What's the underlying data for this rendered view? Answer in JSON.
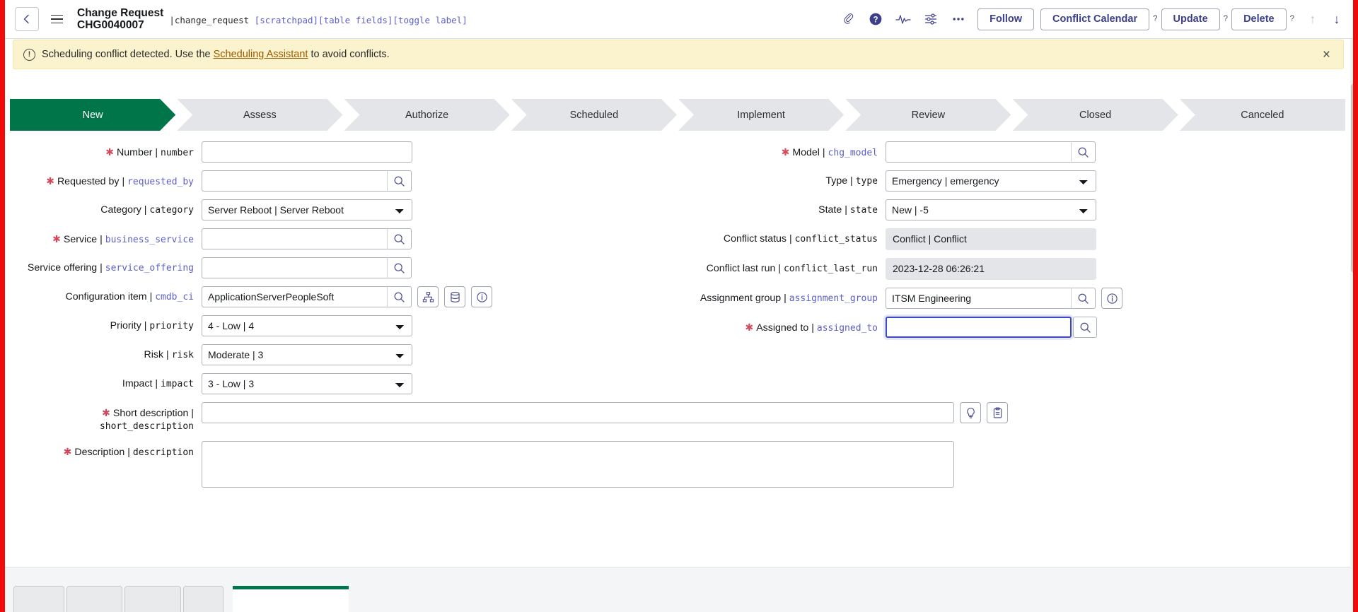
{
  "header": {
    "back_icon": "chevron-left-icon",
    "menu_icon": "hamburger-menu-icon",
    "title_line1": "Change Request",
    "title_line2": "CHG0040007",
    "meta_pipe": "|",
    "meta_table": "change_request",
    "meta_brackets": "[scratchpad][table fields][toggle label]",
    "icons": [
      {
        "name": "attachment-icon",
        "glyph": "attachment"
      },
      {
        "name": "help-icon",
        "glyph": "help"
      },
      {
        "name": "activity-stream-icon",
        "glyph": "activity"
      },
      {
        "name": "personalize-form-icon",
        "glyph": "sliders"
      },
      {
        "name": "more-options-icon",
        "glyph": "ellipsis"
      }
    ],
    "follow_label": "Follow",
    "conflict_calendar_label": "Conflict Calendar",
    "update_label": "Update",
    "delete_label": "Delete",
    "help_marker": "?",
    "up_arrow": "↑",
    "down_arrow": "↓"
  },
  "banner": {
    "icon": "info-circle-icon",
    "icon_glyph": "!",
    "text_before": "Scheduling conflict detected. Use the",
    "link_text": "Scheduling Assistant",
    "text_after": "to avoid conflicts.",
    "close_label": "×",
    "background": "#fbf3cd"
  },
  "flow": {
    "active_color": "#00754a",
    "steps": [
      {
        "label": "New",
        "active": true
      },
      {
        "label": "Assess",
        "active": false
      },
      {
        "label": "Authorize",
        "active": false
      },
      {
        "label": "Scheduled",
        "active": false
      },
      {
        "label": "Implement",
        "active": false
      },
      {
        "label": "Review",
        "active": false
      },
      {
        "label": "Closed",
        "active": false
      },
      {
        "label": "Canceled",
        "active": false
      }
    ]
  },
  "form": {
    "left": [
      {
        "id": "number",
        "label": "Number",
        "field": "number",
        "field_style": "plain",
        "required": true,
        "control": "text",
        "value": "",
        "placeholder": ""
      },
      {
        "id": "requested_by",
        "label": "Requested by",
        "field": "requested_by",
        "field_style": "ref",
        "required": true,
        "control": "reference",
        "value": "",
        "placeholder": "",
        "search_icon": "magnifier-icon"
      },
      {
        "id": "category",
        "label": "Category",
        "field": "category",
        "field_style": "plain",
        "required": false,
        "control": "select",
        "value": "Server Reboot | Server Reboot"
      },
      {
        "id": "business_service",
        "label": "Service",
        "field": "business_service",
        "field_style": "ref",
        "required": true,
        "control": "reference",
        "value": "",
        "placeholder": "",
        "search_icon": "magnifier-icon"
      },
      {
        "id": "service_offering",
        "label": "Service offering",
        "field": "service_offering",
        "field_style": "ref",
        "required": false,
        "control": "reference",
        "value": "",
        "placeholder": "",
        "search_icon": "magnifier-icon"
      },
      {
        "id": "cmdb_ci",
        "label": "Configuration item",
        "field": "cmdb_ci",
        "field_style": "ref",
        "required": false,
        "control": "reference",
        "value": "ApplicationServerPeopleSoft",
        "placeholder": "",
        "search_icon": "magnifier-icon",
        "extra_buttons": [
          {
            "name": "ci-relationship-map-button",
            "icon": "hierarchy-icon"
          },
          {
            "name": "ci-database-button",
            "icon": "database-icon"
          },
          {
            "name": "ci-info-button",
            "icon": "info-icon"
          }
        ]
      },
      {
        "id": "priority",
        "label": "Priority",
        "field": "priority",
        "field_style": "plain",
        "required": false,
        "control": "select",
        "value": "4 - Low | 4"
      },
      {
        "id": "risk",
        "label": "Risk",
        "field": "risk",
        "field_style": "plain",
        "required": false,
        "control": "select",
        "value": "Moderate | 3"
      },
      {
        "id": "impact",
        "label": "Impact",
        "field": "impact",
        "field_style": "plain",
        "required": false,
        "control": "select",
        "value": "3 - Low | 3"
      }
    ],
    "right": [
      {
        "id": "chg_model",
        "label": "Model",
        "field": "chg_model",
        "field_style": "ref",
        "required": true,
        "control": "reference",
        "value": "",
        "placeholder": "",
        "search_icon": "magnifier-icon"
      },
      {
        "id": "type",
        "label": "Type",
        "field": "type",
        "field_style": "plain",
        "required": false,
        "control": "select",
        "value": "Emergency | emergency"
      },
      {
        "id": "state",
        "label": "State",
        "field": "state",
        "field_style": "plain",
        "required": false,
        "control": "select",
        "value": "New | -5"
      },
      {
        "id": "conflict_status",
        "label": "Conflict status",
        "field": "conflict_status",
        "field_style": "plain",
        "required": false,
        "control": "readonly",
        "value": "Conflict | Conflict"
      },
      {
        "id": "conflict_last_run",
        "label": "Conflict last run",
        "field": "conflict_last_run",
        "field_style": "plain",
        "required": false,
        "control": "readonly",
        "value": "2023-12-28 06:26:21"
      },
      {
        "id": "assignment_group",
        "label": "Assignment group",
        "field": "assignment_group",
        "field_style": "ref",
        "required": false,
        "control": "reference",
        "value": "ITSM Engineering",
        "placeholder": "",
        "search_icon": "magnifier-icon",
        "extra_buttons": [
          {
            "name": "assignment-group-info-button",
            "icon": "info-icon"
          }
        ]
      },
      {
        "id": "assigned_to",
        "label": "Assigned to",
        "field": "assigned_to",
        "field_style": "ref",
        "required": true,
        "control": "reference",
        "value": "",
        "placeholder": "",
        "focused": true,
        "search_icon": "magnifier-icon"
      }
    ],
    "full": [
      {
        "id": "short_description",
        "label": "Short description",
        "field": "short_description",
        "field_style": "plain",
        "required": true,
        "control": "text_wide",
        "value": "",
        "placeholder": "",
        "extra_buttons": [
          {
            "name": "short-description-suggestion-button",
            "icon": "lightbulb-icon"
          },
          {
            "name": "short-description-template-button",
            "icon": "clipboard-icon"
          }
        ]
      },
      {
        "id": "description",
        "label": "Description",
        "field": "description",
        "field_style": "plain",
        "required": true,
        "control": "textarea",
        "value": "",
        "placeholder": ""
      }
    ]
  },
  "footer": {
    "tabs": [
      {
        "name": "footer-tab-1",
        "label": ""
      },
      {
        "name": "footer-tab-2",
        "label": ""
      },
      {
        "name": "footer-tab-3",
        "label": ""
      },
      {
        "name": "footer-tab-4",
        "label": ""
      },
      {
        "name": "footer-tab-active",
        "label": ""
      }
    ]
  }
}
